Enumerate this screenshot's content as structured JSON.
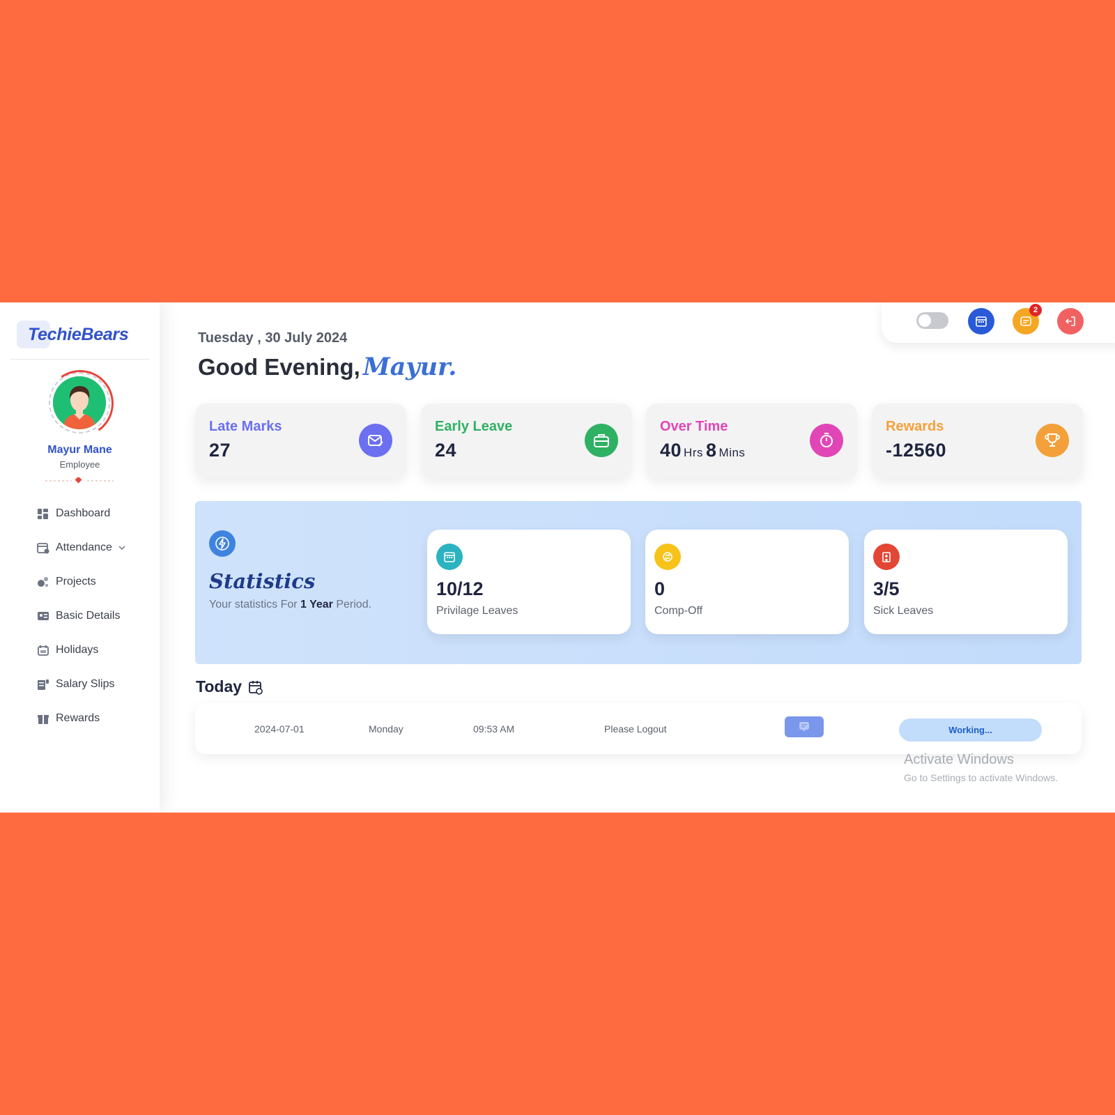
{
  "brand": {
    "logo_text": "TechieBears"
  },
  "user": {
    "name": "Mayur Mane",
    "role": "Employee"
  },
  "nav": {
    "items": [
      {
        "label": "Dashboard"
      },
      {
        "label": "Attendance"
      },
      {
        "label": "Projects"
      },
      {
        "label": "Basic Details"
      },
      {
        "label": "Holidays"
      },
      {
        "label": "Salary Slips"
      },
      {
        "label": "Rewards"
      }
    ]
  },
  "header": {
    "date": "Tuesday , 30 July 2024",
    "greeting": "Good Evening,",
    "greeting_name": "Mayur."
  },
  "topbar": {
    "notification_count": "2"
  },
  "cards": [
    {
      "label": "Late Marks",
      "value": "27",
      "color": "#6b6ff0"
    },
    {
      "label": "Early Leave",
      "value": "24",
      "color": "#2fb163"
    },
    {
      "label": "Over Time",
      "hours": "40",
      "hours_unit": "Hrs",
      "mins": "8",
      "mins_unit": "Mins",
      "color": "#e146b6"
    },
    {
      "label": "Rewards",
      "value": "-12560",
      "color": "#f4a03a"
    }
  ],
  "statistics": {
    "title": "Statistics",
    "subtitle_prefix": "Your statistics For",
    "subtitle_bold": "1 Year",
    "subtitle_suffix": "Period.",
    "items": [
      {
        "value": "10/12",
        "label": "Privilage Leaves",
        "color": "#2bb3c0"
      },
      {
        "value": "0",
        "label": "Comp-Off",
        "color": "#f7c31b"
      },
      {
        "value": "3/5",
        "label": "Sick Leaves",
        "color": "#e34635"
      }
    ]
  },
  "today": {
    "title": "Today",
    "date": "2024-07-01",
    "day": "Monday",
    "time": "09:53 AM",
    "note": "Please Logout",
    "status": "Working..."
  },
  "watermark": {
    "title": "Activate Windows",
    "subtitle": "Go to Settings to activate Windows."
  }
}
